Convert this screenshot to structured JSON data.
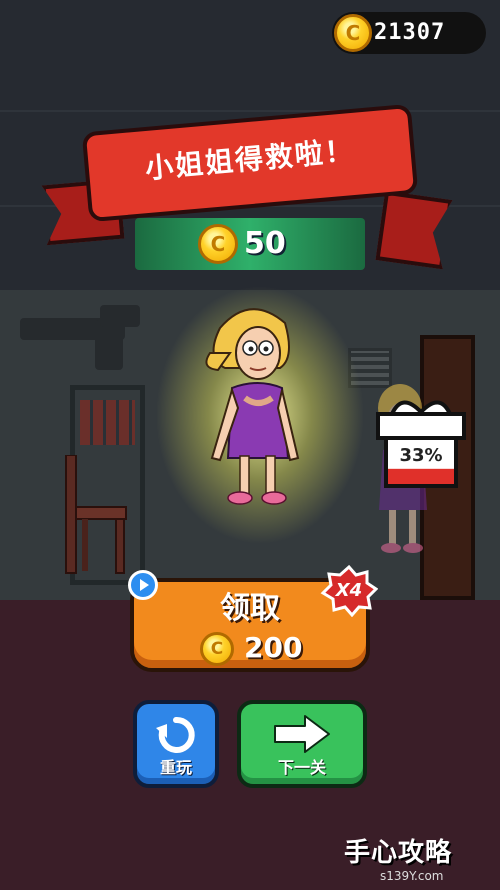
{
  "hud": {
    "coins": "21307",
    "coin_icon": "coin-icon"
  },
  "banner": {
    "title": "小姐姐得救啦！",
    "color": "#e2382a"
  },
  "reward": {
    "amount": "50"
  },
  "gift": {
    "progress_text": "33%",
    "progress": 0.33
  },
  "claim": {
    "label": "领取",
    "amount": "200",
    "multiplier": "X4",
    "color": "#f28a1d"
  },
  "buttons": {
    "replay": {
      "label": "重玩",
      "icon": "replay-icon",
      "color": "#2f86e8"
    },
    "next": {
      "label": "下一关",
      "icon": "arrow-right-icon",
      "color": "#39c25c"
    }
  },
  "watermark": {
    "main": "手心攻略",
    "sub": "s139Y.com"
  }
}
